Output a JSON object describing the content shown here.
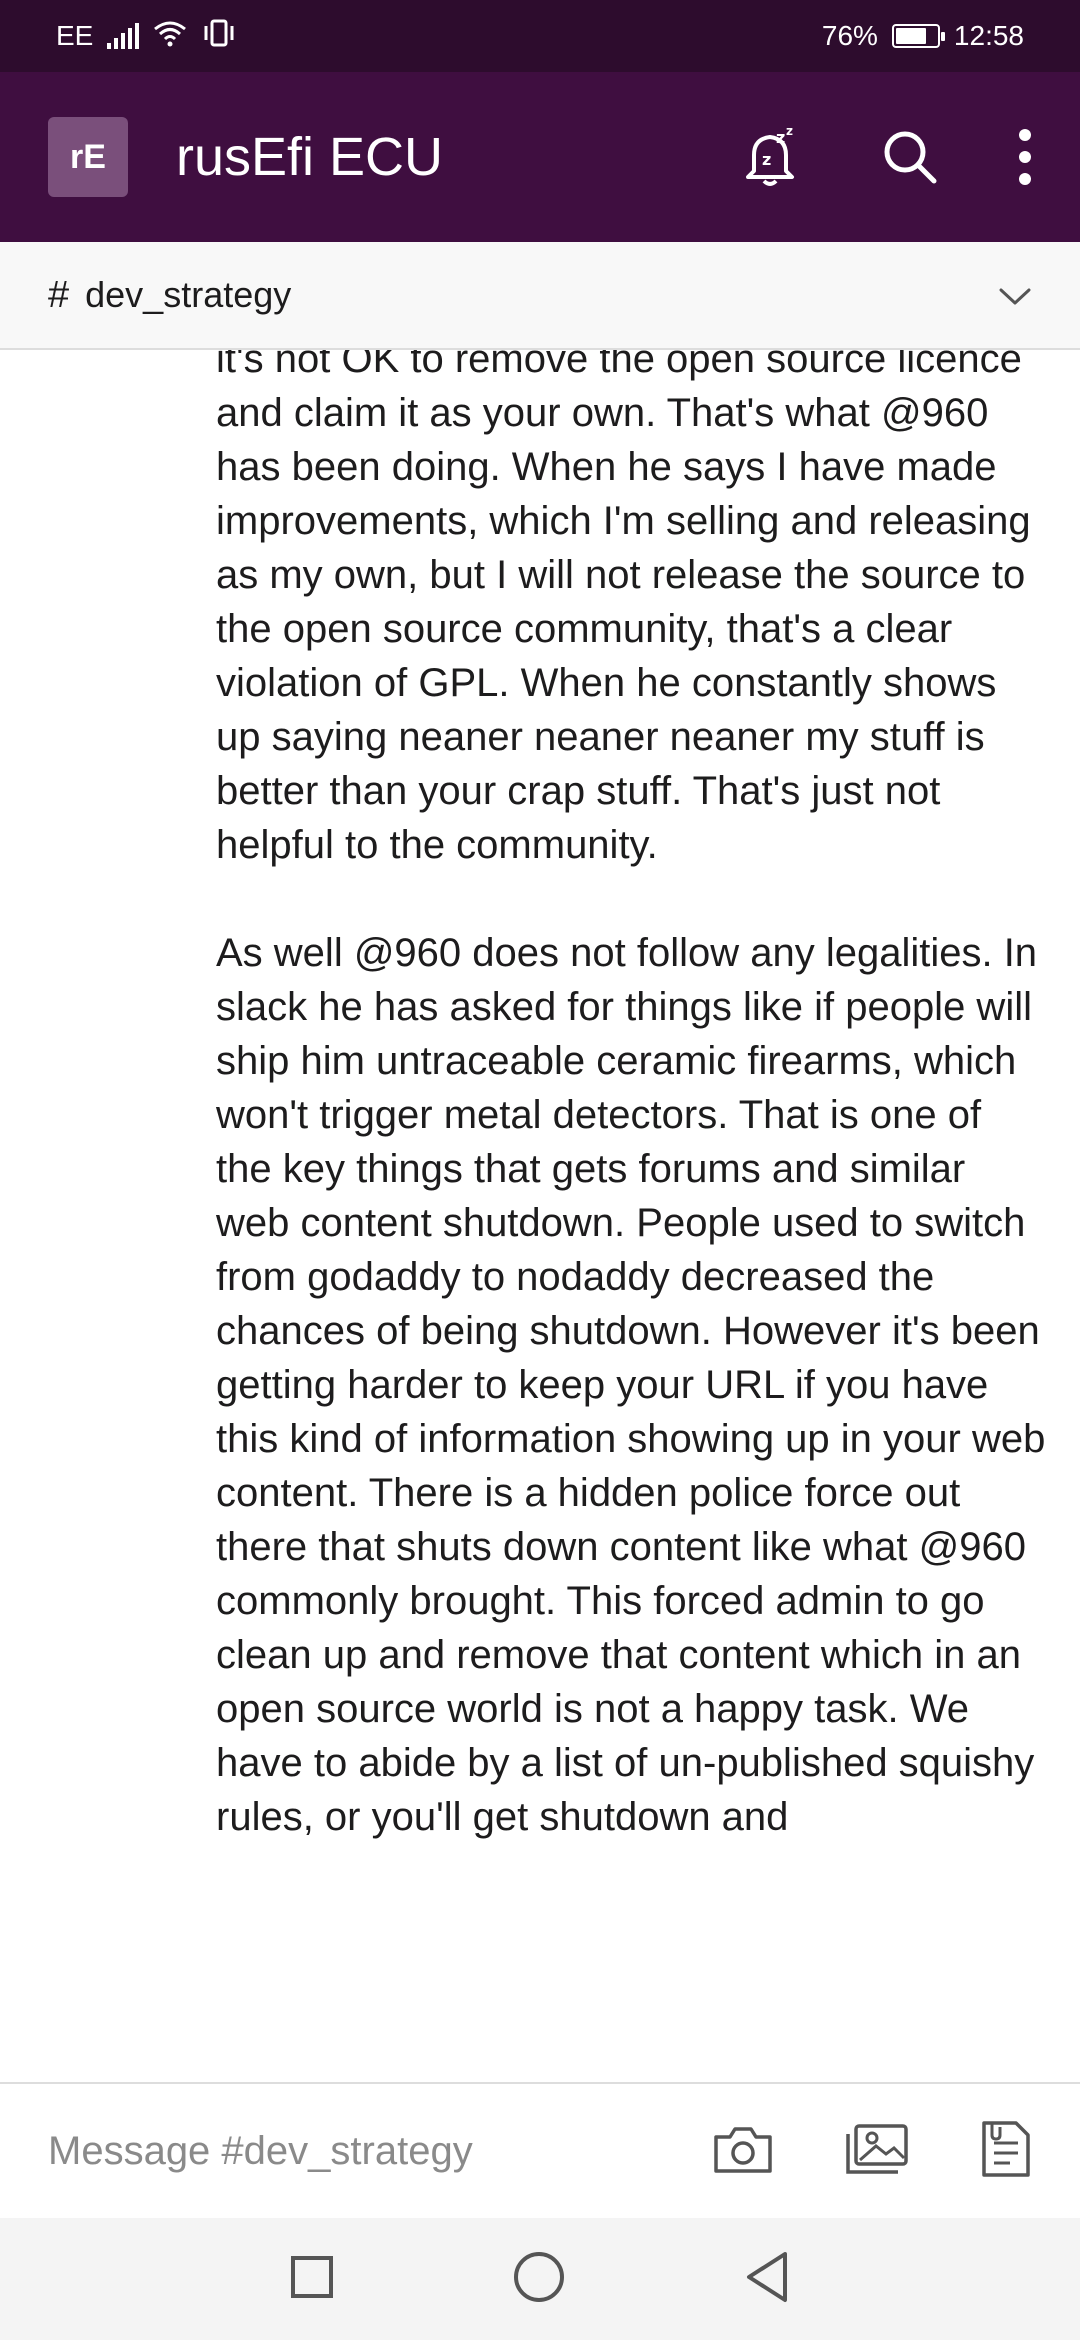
{
  "status_bar": {
    "carrier": "EE",
    "battery_percent": "76%",
    "battery_level": 0.76,
    "time": "12:58",
    "icons": [
      "signal-icon",
      "wifi-icon",
      "vibrate-icon",
      "battery-icon"
    ]
  },
  "header": {
    "workspace_initials": "rE",
    "workspace_name": "rusEfi ECU",
    "icons": [
      "notifications-snoozed-icon",
      "search-icon",
      "more-vert-icon"
    ]
  },
  "channel": {
    "hash": "#",
    "name": "dev_strategy",
    "dropdown_icon": "chevron-down-icon"
  },
  "message": {
    "paragraphs": [
      "it's not OK to remove the open source licence and claim it as your own. That's what @960 has been doing. When he says I have made improvements, which I'm selling and releasing as my own, but I will not release the source to the open source community, that's a clear violation of GPL. When he constantly shows up saying neaner neaner neaner my stuff is better than your crap stuff. That's just not helpful to the community.",
      "As well @960 does not follow any legalities. In slack he has asked for things like if people will ship him untraceable ceramic firearms, which won't trigger metal detectors. That is one of the key things that gets forums and similar web content shutdown. People used to switch from godaddy to nodaddy decreased the chances of being shutdown. However it's been getting harder to keep your URL if you have this kind of information showing up in your web content. There is a hidden police force out there that shuts down content like what @960 commonly brought. This forced admin to go clean up and remove that content which in an open source world is not a happy task. We have to abide by a list of un-published squishy rules, or you'll get shutdown and"
    ]
  },
  "composer": {
    "placeholder": "Message #dev_strategy",
    "icons": [
      "camera-icon",
      "gallery-icon",
      "file-icon"
    ]
  },
  "nav_bar": {
    "icons": [
      "recents-icon",
      "home-icon",
      "back-icon"
    ]
  },
  "colors": {
    "status_bar_bg": "#2d0c2d",
    "header_bg": "#3f0e40",
    "avatar_bg": "#7a4f7b"
  }
}
